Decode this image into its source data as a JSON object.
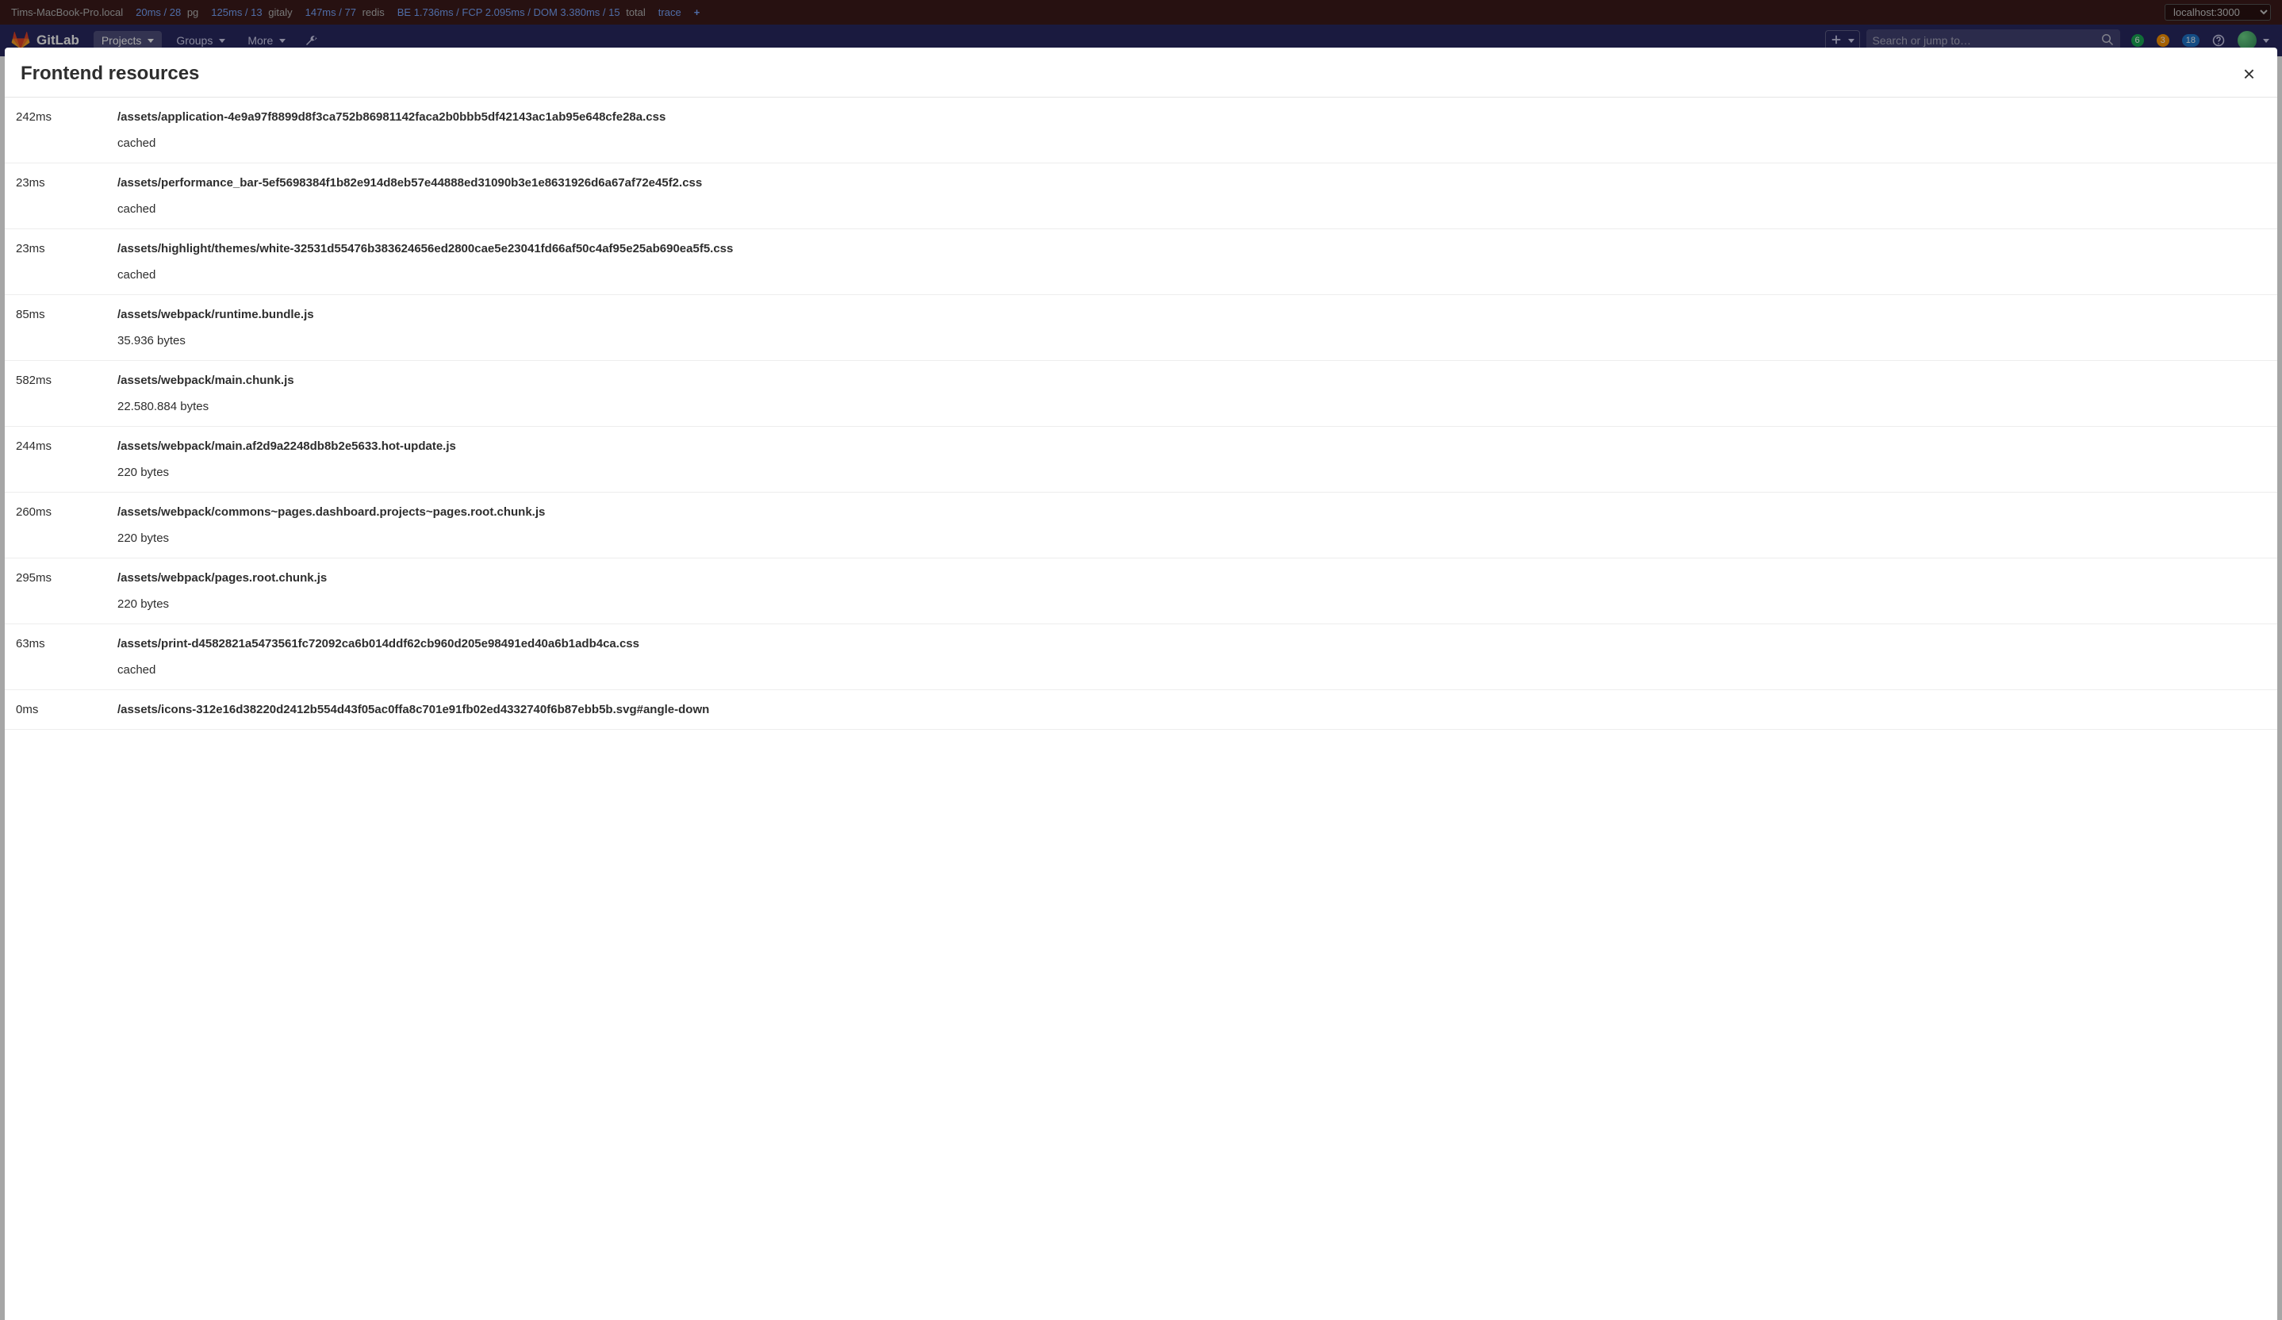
{
  "perf": {
    "host": "Tims-MacBook-Pro.local",
    "pg": {
      "value": "20ms / 28",
      "label": "pg"
    },
    "gitaly": {
      "value": "125ms / 13",
      "label": "gitaly"
    },
    "redis": {
      "value": "147ms / 77",
      "label": "redis"
    },
    "timing": {
      "value": "BE 1.736ms / FCP 2.095ms / DOM 3.380ms / 15",
      "label": "total"
    },
    "trace": "trace",
    "add": "+",
    "host_select": "localhost:3000"
  },
  "nav": {
    "brand": "GitLab",
    "projects": "Projects",
    "groups": "Groups",
    "more": "More",
    "search_placeholder": "Search or jump to…",
    "issues_count": "6",
    "mr_count": "3",
    "todos_count": "18"
  },
  "modal": {
    "title": "Frontend resources",
    "close": "×",
    "rows": [
      {
        "time": "242ms",
        "path": "/assets/application-4e9a97f8899d8f3ca752b86981142faca2b0bbb5df42143ac1ab95e648cfe28a.css",
        "meta": "cached"
      },
      {
        "time": "23ms",
        "path": "/assets/performance_bar-5ef5698384f1b82e914d8eb57e44888ed31090b3e1e8631926d6a67af72e45f2.css",
        "meta": "cached"
      },
      {
        "time": "23ms",
        "path": "/assets/highlight/themes/white-32531d55476b383624656ed2800cae5e23041fd66af50c4af95e25ab690ea5f5.css",
        "meta": "cached"
      },
      {
        "time": "85ms",
        "path": "/assets/webpack/runtime.bundle.js",
        "meta": "35.936 bytes"
      },
      {
        "time": "582ms",
        "path": "/assets/webpack/main.chunk.js",
        "meta": "22.580.884 bytes"
      },
      {
        "time": "244ms",
        "path": "/assets/webpack/main.af2d9a2248db8b2e5633.hot-update.js",
        "meta": "220 bytes"
      },
      {
        "time": "260ms",
        "path": "/assets/webpack/commons~pages.dashboard.projects~pages.root.chunk.js",
        "meta": "220 bytes"
      },
      {
        "time": "295ms",
        "path": "/assets/webpack/pages.root.chunk.js",
        "meta": "220 bytes"
      },
      {
        "time": "63ms",
        "path": "/assets/print-d4582821a5473561fc72092ca6b014ddf62cb960d205e98491ed40a6b1adb4ca.css",
        "meta": "cached"
      },
      {
        "time": "0ms",
        "path": "/assets/icons-312e16d38220d2412b554d43f05ac0ffa8c701e91fb02ed4332740f6b87ebb5b.svg#angle-down",
        "meta": ""
      }
    ]
  }
}
